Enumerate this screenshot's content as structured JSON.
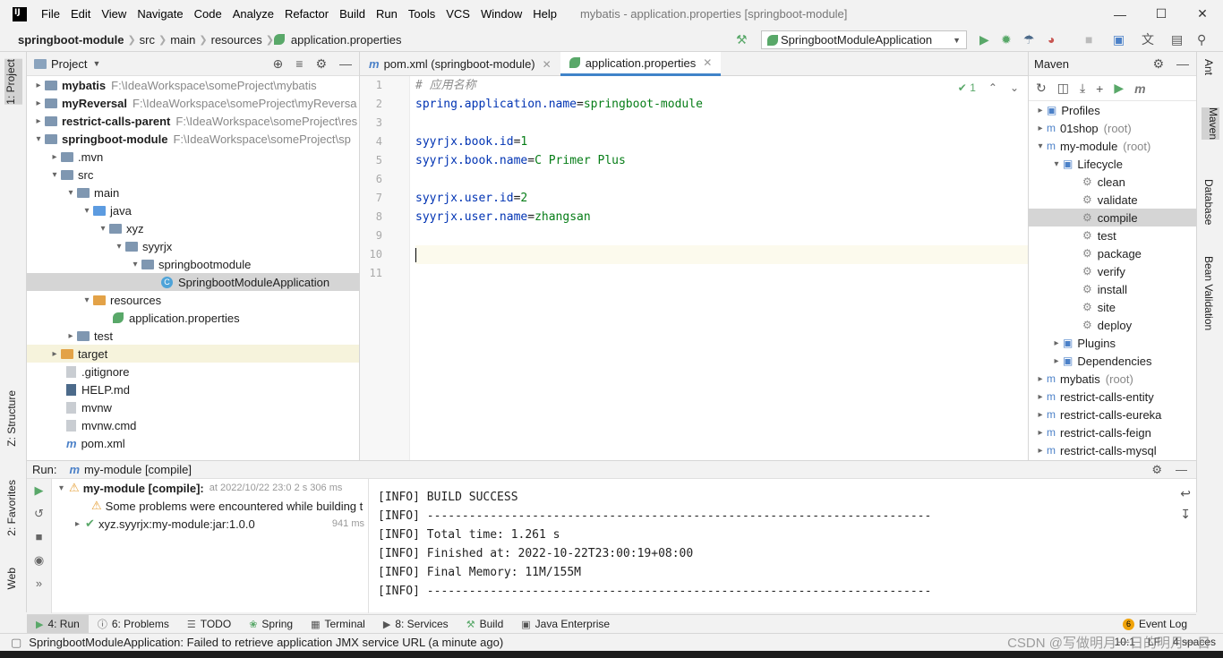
{
  "menubar": {
    "items": [
      "File",
      "Edit",
      "View",
      "Navigate",
      "Code",
      "Analyze",
      "Refactor",
      "Build",
      "Run",
      "Tools",
      "VCS",
      "Window",
      "Help"
    ],
    "window_title": "mybatis - application.properties [springboot-module]"
  },
  "navbar": {
    "crumbs": [
      "springboot-module",
      "src",
      "main",
      "resources",
      "application.properties"
    ],
    "run_config": "SpringbootModuleApplication"
  },
  "left_strip": {
    "project_tab": "1: Project",
    "structure_tab": "Z: Structure",
    "favorites_tab": "2: Favorites",
    "web_tab": "Web"
  },
  "project_panel": {
    "title": "Project",
    "rows": [
      {
        "name": "mybatis",
        "path": "F:\\IdeaWorkspace\\someProject\\mybatis"
      },
      {
        "name": "myReversal",
        "path": "F:\\IdeaWorkspace\\someProject\\myReversa"
      },
      {
        "name": "restrict-calls-parent",
        "path": "F:\\IdeaWorkspace\\someProject\\res"
      },
      {
        "name": "springboot-module",
        "path": "F:\\IdeaWorkspace\\someProject\\sp"
      },
      {
        "name": ".mvn"
      },
      {
        "name": "src"
      },
      {
        "name": "main"
      },
      {
        "name": "java"
      },
      {
        "name": "xyz"
      },
      {
        "name": "syyrjx"
      },
      {
        "name": "springbootmodule"
      },
      {
        "name": "SpringbootModuleApplication"
      },
      {
        "name": "resources"
      },
      {
        "name": "application.properties"
      },
      {
        "name": "test"
      },
      {
        "name": "target"
      },
      {
        "name": ".gitignore"
      },
      {
        "name": "HELP.md"
      },
      {
        "name": "mvnw"
      },
      {
        "name": "mvnw.cmd"
      },
      {
        "name": "pom.xml"
      }
    ]
  },
  "editor": {
    "tabs": [
      "pom.xml (springboot-module)",
      "application.properties"
    ],
    "inspections": "1",
    "line_numbers": [
      "1",
      "2",
      "3",
      "4",
      "5",
      "6",
      "7",
      "8",
      "9",
      "10",
      "11"
    ],
    "lines": [
      {
        "comment": "# 应用名称"
      },
      {
        "key": "spring.application.name",
        "eq": "=",
        "value": "springboot-module"
      },
      {},
      {
        "key": "syyrjx.book.id",
        "eq": "=",
        "value": "1"
      },
      {
        "key": "syyrjx.book.name",
        "eq": "=",
        "value": "C Primer Plus"
      },
      {},
      {
        "key": "syyrjx.user.id",
        "eq": "=",
        "value": "2"
      },
      {
        "key": "syyrjx.user.name",
        "eq": "=",
        "value": "zhangsan"
      },
      {},
      {},
      {}
    ]
  },
  "maven": {
    "title": "Maven",
    "rows": [
      {
        "label": "Profiles"
      },
      {
        "label": "01shop",
        "muted": "(root)"
      },
      {
        "label": "my-module",
        "muted": "(root)"
      },
      {
        "label": "Lifecycle"
      },
      {
        "label": "clean"
      },
      {
        "label": "validate"
      },
      {
        "label": "compile"
      },
      {
        "label": "test"
      },
      {
        "label": "package"
      },
      {
        "label": "verify"
      },
      {
        "label": "install"
      },
      {
        "label": "site"
      },
      {
        "label": "deploy"
      },
      {
        "label": "Plugins"
      },
      {
        "label": "Dependencies"
      },
      {
        "label": "mybatis",
        "muted": "(root)"
      },
      {
        "label": "restrict-calls-entity"
      },
      {
        "label": "restrict-calls-eureka"
      },
      {
        "label": "restrict-calls-feign"
      },
      {
        "label": "restrict-calls-mysql"
      }
    ]
  },
  "right_strip": {
    "ant": "Ant",
    "maven": "Maven",
    "database": "Database",
    "bean_validation": "Bean Validation"
  },
  "run_panel": {
    "label": "Run:",
    "config": "my-module [compile]",
    "tree": [
      {
        "text": "my-module [compile]:",
        "detail": "at 2022/10/22 23:0 2 s 306 ms"
      },
      {
        "text": "Some problems were encountered while building t"
      },
      {
        "text": "xyz.syyrjx:my-module:jar:1.0.0",
        "time": "941 ms"
      }
    ],
    "console": [
      "[INFO] BUILD SUCCESS",
      "[INFO] ------------------------------------------------------------------------",
      "[INFO] Total time: 1.261 s",
      "[INFO] Finished at: 2022-10-22T23:00:19+08:00",
      "[INFO] Final Memory: 11M/155M",
      "[INFO] ------------------------------------------------------------------------"
    ]
  },
  "bottom_tabs": [
    "4: Run",
    "6: Problems",
    "TODO",
    "Spring",
    "Terminal",
    "8: Services",
    "Build",
    "Java Enterprise"
  ],
  "event_log": {
    "count": "6",
    "label": "Event Log"
  },
  "status": {
    "message": "SpringbootModuleApplication: Failed to retrieve application JMX service URL (a minute ago)",
    "position": "10:1",
    "encoding": "LF",
    "indent": "4 spaces"
  },
  "watermark": "CSDN @写做明月一日的明月一日"
}
